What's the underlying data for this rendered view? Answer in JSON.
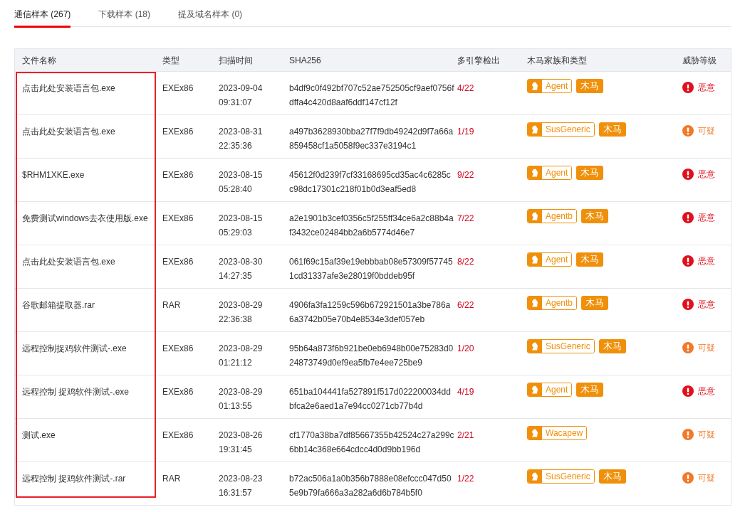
{
  "tabs": [
    {
      "label": "通信样本 (267)",
      "selected": true
    },
    {
      "label": "下载样本 (18)",
      "selected": false
    },
    {
      "label": "提及域名样本 (0)",
      "selected": false
    }
  ],
  "table": {
    "columns": [
      "文件名称",
      "类型",
      "扫描时间",
      "SHA256",
      "多引擎检出",
      "木马家族和类型",
      "威胁等级"
    ],
    "rows": [
      {
        "file_name": "点击此处安装语言包.exe",
        "type": "EXEx86",
        "scan_time": "2023-09-04 09:31:07",
        "sha256": "b4df9c0f492bf707c52ae752505cf9aef0756fdffa4c420d8aaf6ddf147cf12f",
        "detections": "4/22",
        "family": "Agent",
        "category": "木马",
        "threat": {
          "kind": "malicious",
          "label": "恶意"
        }
      },
      {
        "file_name": "点击此处安装语言包.exe",
        "type": "EXEx86",
        "scan_time": "2023-08-31 22:35:36",
        "sha256": "a497b3628930bba27f7f9db49242d9f7a66a859458cf1a5058f9ec337e3194c1",
        "detections": "1/19",
        "family": "SusGeneric",
        "category": "木马",
        "threat": {
          "kind": "suspicious",
          "label": "可疑"
        }
      },
      {
        "file_name": "$RHM1XKE.exe",
        "type": "EXEx86",
        "scan_time": "2023-08-15 05:28:40",
        "sha256": "45612f0d239f7cf33168695cd35ac4c6285cc98dc17301c218f01b0d3eaf5ed8",
        "detections": "9/22",
        "family": "Agent",
        "category": "木马",
        "threat": {
          "kind": "malicious",
          "label": "恶意"
        }
      },
      {
        "file_name": "免费测试windows去衣使用版.exe",
        "type": "EXEx86",
        "scan_time": "2023-08-15 05:29:03",
        "sha256": "a2e1901b3cef0356c5f255ff34ce6a2c88b4af3432ce02484bb2a6b5774d46e7",
        "detections": "7/22",
        "family": "Agentb",
        "category": "木马",
        "threat": {
          "kind": "malicious",
          "label": "恶意"
        }
      },
      {
        "file_name": "点击此处安装语言包.exe",
        "type": "EXEx86",
        "scan_time": "2023-08-30 14:27:35",
        "sha256": "061f69c15af39e19ebbbab08e57309f577451cd31337afe3e28019f0bddeb95f",
        "detections": "8/22",
        "family": "Agent",
        "category": "木马",
        "threat": {
          "kind": "malicious",
          "label": "恶意"
        }
      },
      {
        "file_name": "谷歌邮箱提取器.rar",
        "type": "RAR",
        "scan_time": "2023-08-29 22:36:38",
        "sha256": "4906fa3fa1259c596b672921501a3be786a6a3742b05e70b4e8534e3def057eb",
        "detections": "6/22",
        "family": "Agentb",
        "category": "木马",
        "threat": {
          "kind": "malicious",
          "label": "恶意"
        }
      },
      {
        "file_name": "远程控制捉鸡软件测试-.exe",
        "type": "EXEx86",
        "scan_time": "2023-08-29 01:21:12",
        "sha256": "95b64a873f6b921be0eb6948b00e75283d024873749d0ef9ea5fb7e4ee725be9",
        "detections": "1/20",
        "family": "SusGeneric",
        "category": "木马",
        "threat": {
          "kind": "suspicious",
          "label": "可疑"
        }
      },
      {
        "file_name": "远程控制 捉鸡软件测试-.exe",
        "type": "EXEx86",
        "scan_time": "2023-08-29 01:13:55",
        "sha256": "651ba104441fa527891f517d022200034ddbfca2e6aed1a7e94cc0271cb77b4d",
        "detections": "4/19",
        "family": "Agent",
        "category": "木马",
        "threat": {
          "kind": "malicious",
          "label": "恶意"
        }
      },
      {
        "file_name": "测试.exe",
        "type": "EXEx86",
        "scan_time": "2023-08-26 19:31:45",
        "sha256": "cf1770a38ba7df85667355b42524c27a299c6bb14c368e664cdcc4d0d9bb196d",
        "detections": "2/21",
        "family": "Wacapew",
        "threat": {
          "kind": "suspicious",
          "label": "可疑"
        }
      },
      {
        "file_name": "远程控制 捉鸡软件测试-.rar",
        "type": "RAR",
        "scan_time": "2023-08-23 16:31:57",
        "sha256": "b72ac506a1a0b356b7888e08efccc047d505e9b79fa666a3a282a6d6b784b5f0",
        "detections": "1/22",
        "family": "SusGeneric",
        "category": "木马",
        "threat": {
          "kind": "suspicious",
          "label": "可疑"
        }
      }
    ]
  }
}
